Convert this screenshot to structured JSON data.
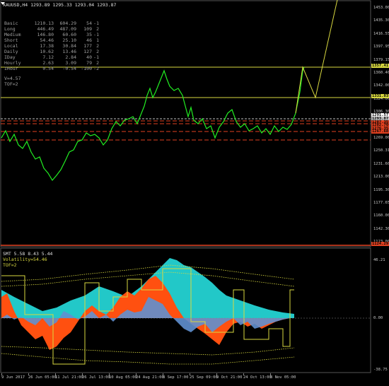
{
  "main_chart": {
    "title": "XAUUSD,H4  1293.89 1295.33 1293.04 1293.87",
    "stats": [
      {
        "label": "Basic",
        "v1": "1210.13",
        "v2": "604.29",
        "v3": "54",
        "v4": "-1"
      },
      {
        "label": "Long",
        "v1": "446.49",
        "v2": "487.09",
        "v3": "109",
        "v4": "2"
      },
      {
        "label": "Medium",
        "v1": "146.80",
        "v2": "60.60",
        "v3": "35",
        "v4": "-1"
      },
      {
        "label": "Short",
        "v1": "54.46",
        "v2": "25.10",
        "v3": "46",
        "v4": "1"
      },
      {
        "label": "Local",
        "v1": "17.38",
        "v2": "30.84",
        "v3": "177",
        "v4": "2"
      },
      {
        "label": "Daily",
        "v1": "10.62",
        "v2": "13.46",
        "v3": "127",
        "v4": "2"
      },
      {
        "label": "IDay",
        "v1": "7.12",
        "v2": "2.84",
        "v3": "40",
        "v4": "-1"
      },
      {
        "label": "Hourly",
        "v1": "2.63",
        "v2": "3.09",
        "v3": "79",
        "v4": "2"
      },
      {
        "label": "IHour",
        "v1": "0.54",
        "v2": "-0.54",
        "v3": "-100",
        "v4": "-2"
      }
    ],
    "v_text": "V=4.57",
    "tof_text": "TOF=2",
    "price_ticks": [
      "1453.00",
      "1435.30",
      "1416.55",
      "1397.95",
      "1379.15",
      "1360.40",
      "1342.00",
      "1324.00",
      "1306.30",
      "1287.75",
      "1269.00",
      "1250.31",
      "1231.60",
      "1213.00",
      "1195.30",
      "1177.65",
      "1160.00",
      "1142.30",
      "1123.00"
    ],
    "price_tags": [
      {
        "text": "1357.41",
        "bg": "#d8d840"
      },
      {
        "text": "1331.03",
        "bg": "#d8d840"
      },
      {
        "text": "1291.57",
        "bg": "#ffffff"
      },
      {
        "text": "1293.87",
        "bg": "#c0c0c0"
      },
      {
        "text": "1287.35",
        "bg": "#e04020"
      },
      {
        "text": "1282.70",
        "bg": "#e04020"
      },
      {
        "text": "1276.35",
        "bg": "#e04020"
      },
      {
        "text": "1267.68",
        "bg": "#e04020"
      },
      {
        "text": "1124.29",
        "bg": "#e04020"
      }
    ]
  },
  "indicator": {
    "title": "SMT 5.58 8.43 5.44",
    "volatility": "Volatility=54.46",
    "tof": "TOF=2",
    "ticks": [
      "46.21",
      "0.00",
      "-38.75"
    ]
  },
  "time_axis": [
    "9 Jun 2017",
    "26 Jun 05:00",
    "11 Jul 21:00",
    "26 Jul 13:00",
    "10 Aug 05:00",
    "24 Aug 21:00",
    "8 Sep 17:00",
    "25 Sep 09:00",
    "9 Oct 21:00",
    "24 Oct 13:00",
    "8 Nov 05:00"
  ],
  "colors": {
    "background": "#000000",
    "price_line": "#22ee22",
    "level_yellow": "#d8d840",
    "level_red": "#e04020",
    "cyan": "#22c8c8",
    "orange": "#ff5010",
    "steel_blue": "#6090d0"
  }
}
